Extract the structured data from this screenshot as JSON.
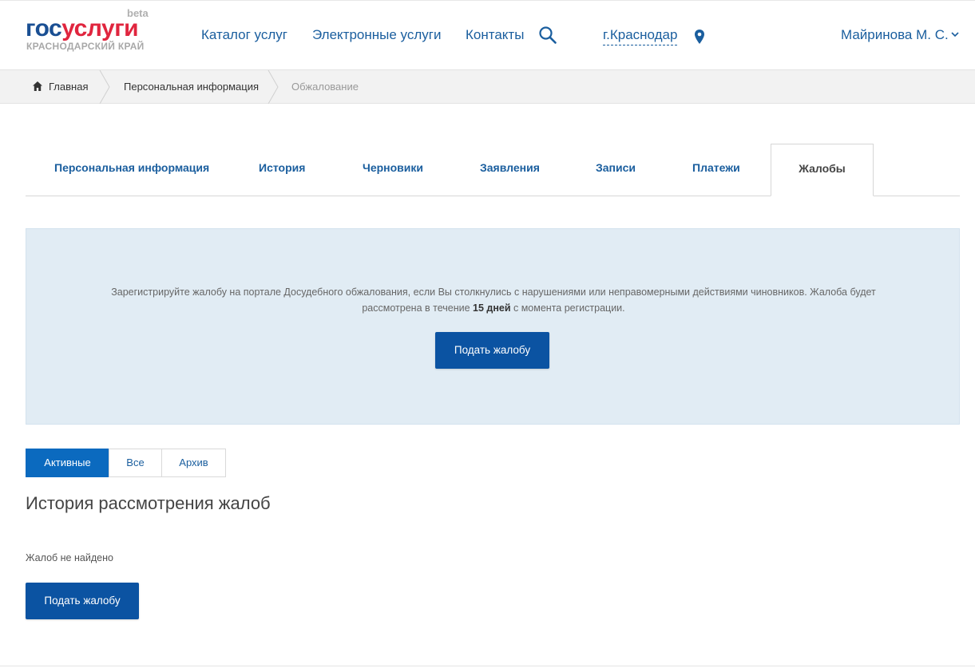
{
  "header": {
    "logo_gos": "гос",
    "logo_uslugi": "услуги",
    "logo_beta": "beta",
    "logo_region": "КРАСНОДАРСКИЙ КРАЙ",
    "nav": [
      "Каталог услуг",
      "Электронные услуги",
      "Контакты"
    ],
    "search_icon": "search-icon",
    "city": "г.Краснодар",
    "pin_icon": "map-pin-icon",
    "user_name": "Майринова М. С.",
    "user_menu_icon": "chevron-down-icon"
  },
  "breadcrumb": {
    "home_icon": "home-icon",
    "items": [
      "Главная",
      "Персональная информация",
      "Обжалование"
    ]
  },
  "tabs": {
    "items": [
      "Персональная информация",
      "История",
      "Черновики",
      "Заявления",
      "Записи",
      "Платежи",
      "Жалобы"
    ],
    "active": "Жалобы"
  },
  "info_panel": {
    "text_part1": "Зарегистрируйте жалобу на портале Досудебного обжалования, если Вы столкнулись с нарушениями или неправомерными действиями чиновников. Жалоба будет рассмотрена в течение ",
    "text_bold": "15 дней",
    "text_part2": " с момента регистрации.",
    "button_label": "Подать жалобу"
  },
  "filter": {
    "items": [
      "Активные",
      "Все",
      "Архив"
    ],
    "active": "Активные"
  },
  "history": {
    "title": "История рассмотрения жалоб",
    "empty_text": "Жалоб не найдено",
    "button_label": "Подать жалобу"
  },
  "colors": {
    "brand_blue": "#1a4f93",
    "brand_red": "#e0253e",
    "link": "#1a5e9e",
    "button": "#0b53a2",
    "panel_bg": "#e1ecf4"
  }
}
